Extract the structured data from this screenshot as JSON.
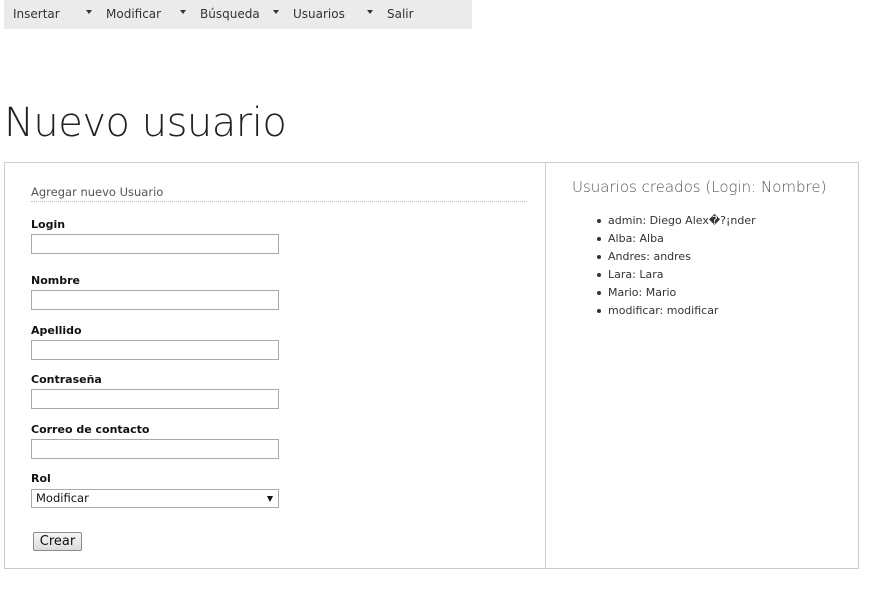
{
  "nav": {
    "items": [
      {
        "label": "Insertar",
        "has_menu": true
      },
      {
        "label": "Modificar",
        "has_menu": true
      },
      {
        "label": "Búsqueda",
        "has_menu": true
      },
      {
        "label": "Usuarios",
        "has_menu": true
      },
      {
        "label": "Salir",
        "has_menu": false
      }
    ]
  },
  "page": {
    "title": "Nuevo usuario"
  },
  "form": {
    "legend": "Agregar nuevo Usuario",
    "fields": {
      "login": {
        "label": "Login",
        "value": ""
      },
      "nombre": {
        "label": "Nombre",
        "value": ""
      },
      "apellido": {
        "label": "Apellido",
        "value": ""
      },
      "contrasena": {
        "label": "Contraseña",
        "value": ""
      },
      "correo": {
        "label": "Correo de contacto",
        "value": ""
      }
    },
    "rol": {
      "label": "Rol",
      "selected": "Modificar"
    },
    "submit_label": "Crear"
  },
  "users": {
    "heading": "Usuarios creados (Login: Nombre)",
    "items": [
      "admin: Diego Alex�?¡nder",
      "Alba: Alba",
      "Andres: andres",
      "Lara: Lara",
      "Mario: Mario",
      "modificar: modificar"
    ]
  }
}
